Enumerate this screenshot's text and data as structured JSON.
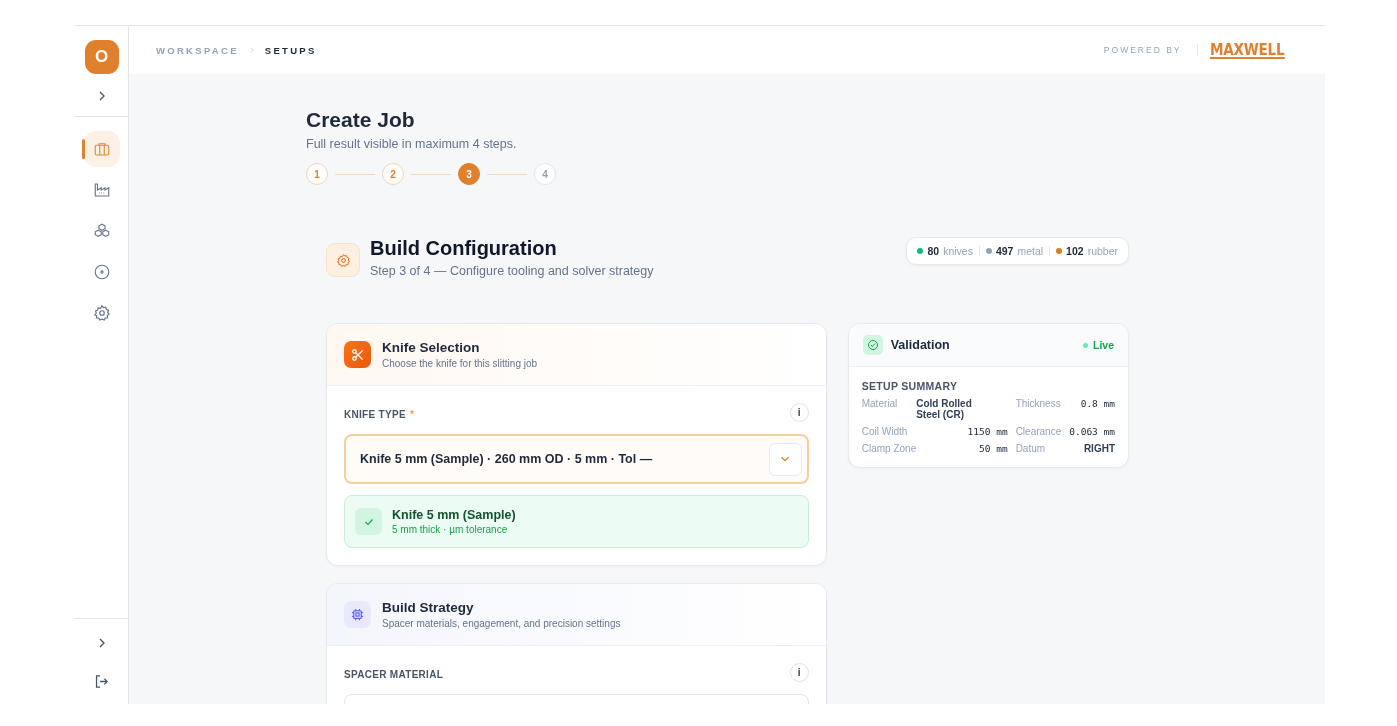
{
  "sidebar": {
    "avatar": "O",
    "nav": [
      {
        "selected": true
      },
      {
        "selected": false
      },
      {
        "selected": false
      },
      {
        "selected": false
      },
      {
        "selected": false
      }
    ]
  },
  "header": {
    "breadcrumb": [
      "WORKSPACE",
      "SETUPS"
    ],
    "powered_by": "POWERED BY",
    "logo": "MAXWELL"
  },
  "page": {
    "title": "Create Job",
    "subtitle": "Full result visible in maximum 4 steps.",
    "steps": [
      {
        "label": "1",
        "completed": true,
        "selected": false
      },
      {
        "label": "2",
        "completed": true,
        "selected": false
      },
      {
        "label": "3",
        "completed": false,
        "selected": true
      },
      {
        "label": "4",
        "completed": false,
        "selected": false
      }
    ]
  },
  "section": {
    "title": "Build Configuration",
    "subtitle": "Step 3 of 4 — Configure tooling and solver strategy",
    "stats": [
      {
        "value": "80",
        "label": "knives",
        "color": "#10b981"
      },
      {
        "value": "497",
        "label": "metal",
        "color": "#94a3b8"
      },
      {
        "value": "102",
        "label": "rubber",
        "color": "#e07a1f"
      }
    ]
  },
  "knife_card": {
    "title": "Knife Selection",
    "subtitle": "Choose the knife for this slitting job",
    "field_label": "KNIFE TYPE",
    "required_mark": "*",
    "info": "i",
    "value": "Knife 5 mm (Sample) · 260 mm OD · 5 mm · Tol —",
    "selected_name": "Knife 5 mm (Sample)",
    "selected_detail": "5 mm thick · µm tolerance"
  },
  "strategy_card": {
    "title": "Build Strategy",
    "subtitle": "Spacer materials, engagement, and precision settings",
    "field_label": "SPACER MATERIAL",
    "info": "i"
  },
  "validation": {
    "title": "Validation",
    "status": "Live",
    "summary_title": "SETUP SUMMARY",
    "rows": [
      {
        "label": "Material",
        "value": "Cold Rolled Steel (CR)",
        "mono": false
      },
      {
        "label": "Thickness",
        "value": "0.8 mm",
        "mono": true
      },
      {
        "label": "Coil Width",
        "value": "1150 mm",
        "mono": true
      },
      {
        "label": "Clearance",
        "value": "0.063 mm",
        "mono": true
      },
      {
        "label": "Clamp Zone",
        "value": "50 mm",
        "mono": true
      },
      {
        "label": "Datum",
        "value": "RIGHT",
        "mono": false
      }
    ]
  }
}
